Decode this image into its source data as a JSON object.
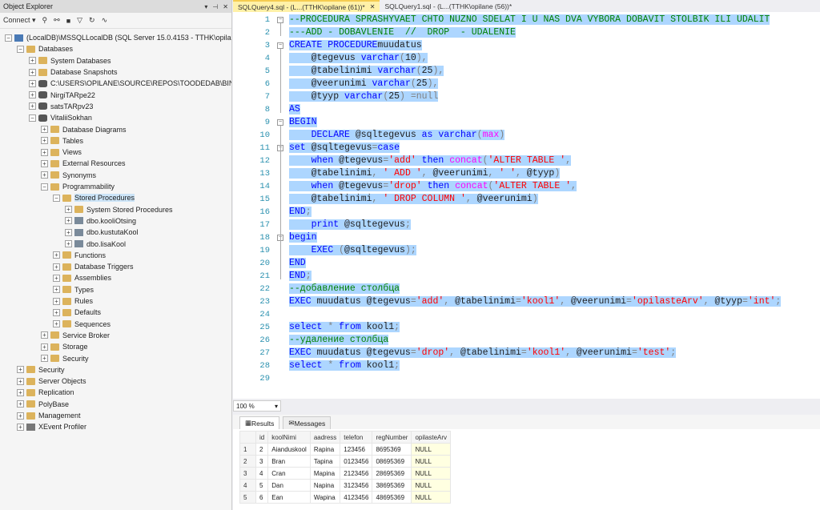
{
  "object_explorer": {
    "title": "Object Explorer",
    "controls": [
      "▾",
      "⊣",
      "✕"
    ],
    "toolbar": {
      "connect_label": "Connect ▾"
    },
    "tree": [
      {
        "label": "(LocalDB)\\MSSQLLocalDB (SQL Server 15.0.4153 - TTHK\\opilane)",
        "icon": "server-icon",
        "expander": "−",
        "level": 0
      },
      {
        "label": "Databases",
        "icon": "folder-icon",
        "expander": "−",
        "level": 1
      },
      {
        "label": "System Databases",
        "icon": "folder-icon",
        "expander": "+",
        "level": 2
      },
      {
        "label": "Database Snapshots",
        "icon": "folder-icon",
        "expander": "+",
        "level": 2
      },
      {
        "label": "C:\\USERS\\OPILANE\\SOURCE\\REPOS\\TOODEDAB\\BIN",
        "icon": "database-icon",
        "expander": "+",
        "level": 2
      },
      {
        "label": "NirgiTARpe22",
        "icon": "database-icon",
        "expander": "+",
        "level": 2
      },
      {
        "label": "satsTARpv23",
        "icon": "database-icon",
        "expander": "+",
        "level": 2
      },
      {
        "label": "VitaliiSokhan",
        "icon": "database-icon",
        "expander": "−",
        "level": 2
      },
      {
        "label": "Database Diagrams",
        "icon": "folder-icon",
        "expander": "+",
        "level": 3
      },
      {
        "label": "Tables",
        "icon": "folder-icon",
        "expander": "+",
        "level": 3
      },
      {
        "label": "Views",
        "icon": "folder-icon",
        "expander": "+",
        "level": 3
      },
      {
        "label": "External Resources",
        "icon": "folder-icon",
        "expander": "+",
        "level": 3
      },
      {
        "label": "Synonyms",
        "icon": "folder-icon",
        "expander": "+",
        "level": 3
      },
      {
        "label": "Programmability",
        "icon": "folder-icon",
        "expander": "−",
        "level": 3
      },
      {
        "label": "Stored Procedures",
        "icon": "folder-icon",
        "expander": "−",
        "level": 4,
        "selected": true
      },
      {
        "label": "System Stored Procedures",
        "icon": "folder-icon",
        "expander": "+",
        "level": 5
      },
      {
        "label": "dbo.kooliOtsing",
        "icon": "procedure-icon",
        "expander": "+",
        "level": 5
      },
      {
        "label": "dbo.kustutaKool",
        "icon": "procedure-icon",
        "expander": "+",
        "level": 5
      },
      {
        "label": "dbo.lisaKool",
        "icon": "procedure-icon",
        "expander": "+",
        "level": 5
      },
      {
        "label": "Functions",
        "icon": "folder-icon",
        "expander": "+",
        "level": 4
      },
      {
        "label": "Database Triggers",
        "icon": "folder-icon",
        "expander": "+",
        "level": 4
      },
      {
        "label": "Assemblies",
        "icon": "folder-icon",
        "expander": "+",
        "level": 4
      },
      {
        "label": "Types",
        "icon": "folder-icon",
        "expander": "+",
        "level": 4
      },
      {
        "label": "Rules",
        "icon": "folder-icon",
        "expander": "+",
        "level": 4
      },
      {
        "label": "Defaults",
        "icon": "folder-icon",
        "expander": "+",
        "level": 4
      },
      {
        "label": "Sequences",
        "icon": "folder-icon",
        "expander": "+",
        "level": 4
      },
      {
        "label": "Service Broker",
        "icon": "folder-icon",
        "expander": "+",
        "level": 3
      },
      {
        "label": "Storage",
        "icon": "folder-icon",
        "expander": "+",
        "level": 3
      },
      {
        "label": "Security",
        "icon": "folder-icon",
        "expander": "+",
        "level": 3
      },
      {
        "label": "Security",
        "icon": "folder-icon",
        "expander": "+",
        "level": 1
      },
      {
        "label": "Server Objects",
        "icon": "folder-icon",
        "expander": "+",
        "level": 1
      },
      {
        "label": "Replication",
        "icon": "folder-icon",
        "expander": "+",
        "level": 1
      },
      {
        "label": "PolyBase",
        "icon": "folder-icon",
        "expander": "+",
        "level": 1
      },
      {
        "label": "Management",
        "icon": "folder-icon",
        "expander": "+",
        "level": 1
      },
      {
        "label": "XEvent Profiler",
        "icon": "xevent-icon",
        "expander": "+",
        "level": 1
      }
    ]
  },
  "tabs": [
    {
      "label": "SQLQuery4.sql - (L...(TTHK\\opilane (61))*",
      "close": "✕",
      "active": true
    },
    {
      "label": "SQLQuery1.sql - (L...(TTHK\\opilane (56))*",
      "close": "",
      "active": false
    }
  ],
  "editor": {
    "lines": [
      [
        [
          "cmt",
          "--PROCEDURA SPRASHYVAET CHTO NUZNO SDELAT I U NAS DVA VYBORA DOBAVIT STOLBIK ILI UDALIT"
        ]
      ],
      [
        [
          "cmt",
          "---ADD - DOBAVLENIE  //  DROP  - UDALENIE"
        ]
      ],
      [
        [
          "kw",
          "CREATE PROCEDURE"
        ],
        [
          "",
          "muudatus"
        ]
      ],
      [
        [
          "",
          "    @tegevus "
        ],
        [
          "kw",
          "varchar"
        ],
        [
          "op",
          "("
        ],
        [
          "",
          "10"
        ],
        [
          "op",
          "),"
        ]
      ],
      [
        [
          "",
          "    @tabelinimi "
        ],
        [
          "kw",
          "varchar"
        ],
        [
          "op",
          "("
        ],
        [
          "",
          "25"
        ],
        [
          "op",
          "),"
        ]
      ],
      [
        [
          "",
          "    @veerunimi "
        ],
        [
          "kw",
          "varchar"
        ],
        [
          "op",
          "("
        ],
        [
          "",
          "25"
        ],
        [
          "op",
          "),"
        ]
      ],
      [
        [
          "",
          "    @tyyp "
        ],
        [
          "kw",
          "varchar"
        ],
        [
          "op",
          "("
        ],
        [
          "",
          "25"
        ],
        [
          "op",
          ")"
        ],
        [
          "gr",
          " =null"
        ]
      ],
      [
        [
          "kw",
          "AS"
        ]
      ],
      [
        [
          "kw",
          "BEGIN"
        ]
      ],
      [
        [
          "",
          "    "
        ],
        [
          "kw",
          "DECLARE"
        ],
        [
          "",
          " @sqltegevus "
        ],
        [
          "kw",
          "as varchar"
        ],
        [
          "op",
          "("
        ],
        [
          "fn",
          "max"
        ],
        [
          "op",
          ")"
        ]
      ],
      [
        [
          "kw",
          "set"
        ],
        [
          "",
          " @sqltegevus"
        ],
        [
          "op",
          "="
        ],
        [
          "kw",
          "case"
        ]
      ],
      [
        [
          "",
          "    "
        ],
        [
          "kw",
          "when"
        ],
        [
          "",
          " @tegevus"
        ],
        [
          "op",
          "="
        ],
        [
          "str",
          "'add'"
        ],
        [
          "kw",
          " then "
        ],
        [
          "fn",
          "concat"
        ],
        [
          "op",
          "("
        ],
        [
          "str",
          "'ALTER TABLE '"
        ],
        [
          "op",
          ","
        ]
      ],
      [
        [
          "",
          "    @tabelinimi"
        ],
        [
          "op",
          ","
        ],
        [
          "str",
          " ' ADD '"
        ],
        [
          "op",
          ","
        ],
        [
          "",
          " @veerunimi"
        ],
        [
          "op",
          ","
        ],
        [
          "str",
          " ' '"
        ],
        [
          "op",
          ","
        ],
        [
          "",
          " @tyyp"
        ],
        [
          "op",
          ")"
        ]
      ],
      [
        [
          "",
          "    "
        ],
        [
          "kw",
          "when"
        ],
        [
          "",
          " @tegevus"
        ],
        [
          "op",
          "="
        ],
        [
          "str",
          "'drop'"
        ],
        [
          "kw",
          " then "
        ],
        [
          "fn",
          "concat"
        ],
        [
          "op",
          "("
        ],
        [
          "str",
          "'ALTER TABLE '"
        ],
        [
          "op",
          ","
        ]
      ],
      [
        [
          "",
          "    @tabelinimi"
        ],
        [
          "op",
          ","
        ],
        [
          "str",
          " ' DROP COLUMN '"
        ],
        [
          "op",
          ","
        ],
        [
          "",
          " @veerunimi"
        ],
        [
          "op",
          ")"
        ]
      ],
      [
        [
          "kw",
          "END"
        ],
        [
          "op",
          ";"
        ]
      ],
      [
        [
          "",
          "    "
        ],
        [
          "kw",
          "print"
        ],
        [
          "",
          " @sqltegevus"
        ],
        [
          "op",
          ";"
        ]
      ],
      [
        [
          "kw",
          "begin"
        ]
      ],
      [
        [
          "",
          "    "
        ],
        [
          "kw",
          "EXEC"
        ],
        [
          "op",
          " ("
        ],
        [
          "",
          "@sqltegevus"
        ],
        [
          "op",
          ");"
        ]
      ],
      [
        [
          "kw",
          "END"
        ]
      ],
      [
        [
          "kw",
          "END"
        ],
        [
          "op",
          ";"
        ]
      ],
      [
        [
          "cmt",
          "--добавление столбца"
        ]
      ],
      [
        [
          "kw",
          "EXEC"
        ],
        [
          "",
          " muudatus @tegevus"
        ],
        [
          "op",
          "="
        ],
        [
          "str",
          "'add'"
        ],
        [
          "op",
          ","
        ],
        [
          "",
          " @tabelinimi"
        ],
        [
          "op",
          "="
        ],
        [
          "str",
          "'kool1'"
        ],
        [
          "op",
          ","
        ],
        [
          "",
          " @veerunimi"
        ],
        [
          "op",
          "="
        ],
        [
          "str",
          "'opilasteArv'"
        ],
        [
          "op",
          ","
        ],
        [
          "",
          " @tyyp"
        ],
        [
          "op",
          "="
        ],
        [
          "str",
          "'int'"
        ],
        [
          "op",
          ";"
        ]
      ],
      [],
      [
        [
          "kw",
          "select"
        ],
        [
          "op",
          " * "
        ],
        [
          "kw",
          "from"
        ],
        [
          "",
          " kool1"
        ],
        [
          "op",
          ";"
        ]
      ],
      [
        [
          "cmt",
          "--удаление столбца"
        ]
      ],
      [
        [
          "kw",
          "EXEC"
        ],
        [
          "",
          " muudatus @tegevus"
        ],
        [
          "op",
          "="
        ],
        [
          "str",
          "'drop'"
        ],
        [
          "op",
          ","
        ],
        [
          "",
          " @tabelinimi"
        ],
        [
          "op",
          "="
        ],
        [
          "str",
          "'kool1'"
        ],
        [
          "op",
          ","
        ],
        [
          "",
          " @veerunimi"
        ],
        [
          "op",
          "="
        ],
        [
          "str",
          "'test'"
        ],
        [
          "op",
          ";"
        ]
      ],
      [
        [
          "kw",
          "select"
        ],
        [
          "op",
          " * "
        ],
        [
          "kw",
          "from"
        ],
        [
          "",
          " kool1"
        ],
        [
          "op",
          ";"
        ]
      ],
      []
    ],
    "fold_markers": [
      {
        "line": 1,
        "sign": "−"
      },
      {
        "line": 3,
        "sign": "−"
      },
      {
        "line": 9,
        "sign": "−"
      },
      {
        "line": 11,
        "sign": "−"
      },
      {
        "line": 18,
        "sign": "−"
      }
    ]
  },
  "zoom": {
    "value": "100 %",
    "arrow": "▾"
  },
  "result_tabs": [
    {
      "label": "Results",
      "icon": "grid-icon",
      "active": true
    },
    {
      "label": "Messages",
      "icon": "messages-icon",
      "active": false
    }
  ],
  "results": {
    "columns": [
      "id",
      "koolNimi",
      "aadress",
      "telefon",
      "regNumber",
      "opilasteArv"
    ],
    "rows": [
      [
        "1",
        "2",
        "Aianduskool",
        "Rapina",
        "123456",
        "8695369",
        "NULL"
      ],
      [
        "2",
        "3",
        "Bran",
        "Tapina",
        "0123456",
        "08695369",
        "NULL"
      ],
      [
        "3",
        "4",
        "Cran",
        "Mapina",
        "2123456",
        "28695369",
        "NULL"
      ],
      [
        "4",
        "5",
        "Dan",
        "Napina",
        "3123456",
        "38695369",
        "NULL"
      ],
      [
        "5",
        "6",
        "Ean",
        "Wapina",
        "4123456",
        "48695369",
        "NULL"
      ]
    ]
  },
  "colors": {
    "selection": "#add6ff",
    "keyword": "#0000ff",
    "string": "#ff0000",
    "comment": "#008000",
    "function": "#ff00ff",
    "line_number": "#2b91af",
    "active_tab": "#fff1a8"
  }
}
